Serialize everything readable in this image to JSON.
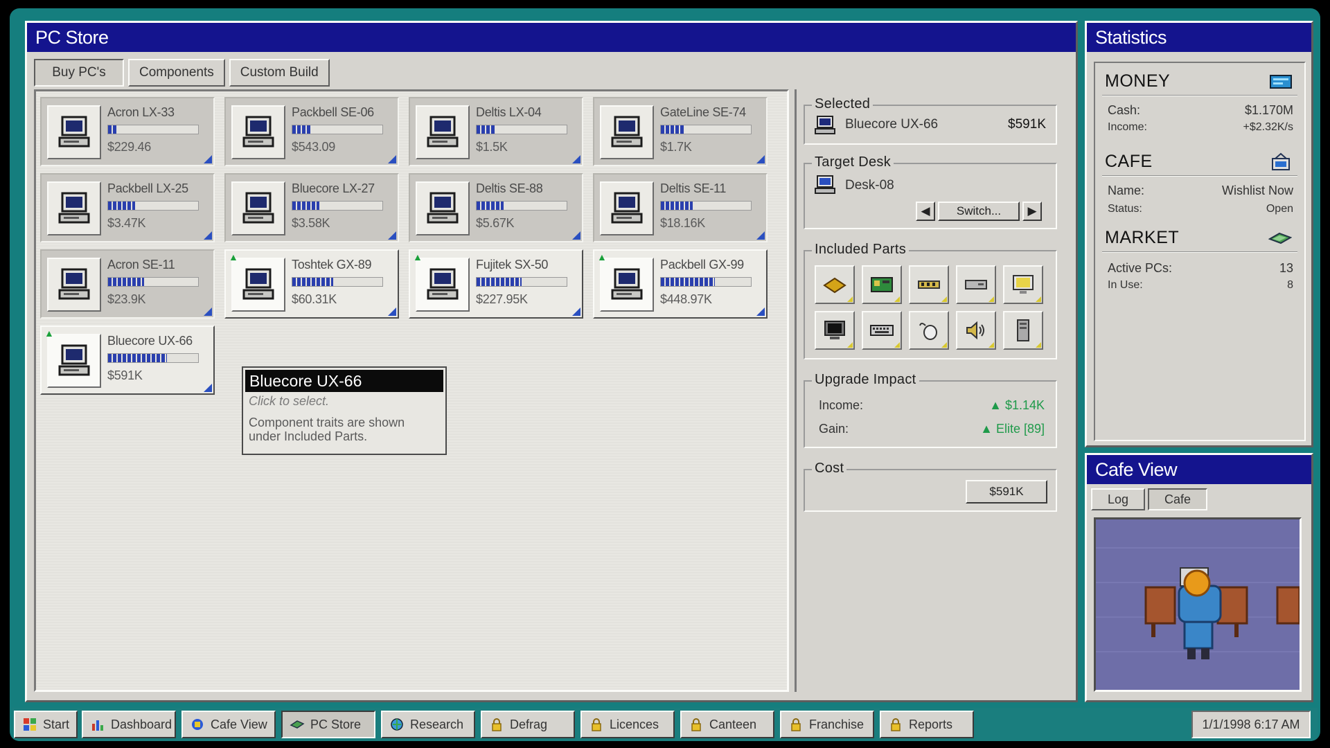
{
  "pc_store": {
    "title": "PC Store",
    "tabs": [
      "Buy PC's",
      "Components",
      "Custom Build"
    ],
    "products": [
      {
        "name": "Acron LX-33",
        "price": "$229.46",
        "rating": 0.1,
        "owned": false,
        "upgrade": false
      },
      {
        "name": "Packbell SE-06",
        "price": "$543.09",
        "rating": 0.2,
        "owned": false,
        "upgrade": false
      },
      {
        "name": "Deltis LX-04",
        "price": "$1.5K",
        "rating": 0.2,
        "owned": false,
        "upgrade": false
      },
      {
        "name": "GateLine SE-74",
        "price": "$1.7K",
        "rating": 0.25,
        "owned": false,
        "upgrade": false
      },
      {
        "name": "Packbell LX-25",
        "price": "$3.47K",
        "rating": 0.3,
        "owned": false,
        "upgrade": false
      },
      {
        "name": "Bluecore LX-27",
        "price": "$3.58K",
        "rating": 0.3,
        "owned": false,
        "upgrade": false
      },
      {
        "name": "Deltis SE-88",
        "price": "$5.67K",
        "rating": 0.3,
        "owned": false,
        "upgrade": false
      },
      {
        "name": "Deltis SE-11",
        "price": "$18.16K",
        "rating": 0.35,
        "owned": false,
        "upgrade": false
      },
      {
        "name": "Acron SE-11",
        "price": "$23.9K",
        "rating": 0.4,
        "owned": false,
        "upgrade": false
      },
      {
        "name": "Toshtek GX-89",
        "price": "$60.31K",
        "rating": 0.45,
        "owned": true,
        "upgrade": true
      },
      {
        "name": "Fujitek SX-50",
        "price": "$227.95K",
        "rating": 0.5,
        "owned": true,
        "upgrade": true
      },
      {
        "name": "Packbell GX-99",
        "price": "$448.97K",
        "rating": 0.6,
        "owned": true,
        "upgrade": true
      },
      {
        "name": "Bluecore UX-66",
        "price": "$591K",
        "rating": 0.65,
        "owned": true,
        "upgrade": true
      }
    ],
    "tooltip": {
      "title": "Bluecore UX-66",
      "hint": "Click to select.",
      "body": "Component traits are shown under Included Parts."
    },
    "selected": {
      "legend": "Selected",
      "name": "Bluecore UX-66",
      "price": "$591K"
    },
    "target_desk": {
      "legend": "Target Desk",
      "desk": "Desk-08",
      "switch_label": "Switch..."
    },
    "included_parts": {
      "legend": "Included Parts",
      "parts": [
        "cpu-icon",
        "motherboard-icon",
        "ram-icon",
        "drive-icon",
        "monitor-icon",
        "crt-icon",
        "keyboard-icon",
        "mouse-icon",
        "speaker-icon",
        "tower-icon"
      ]
    },
    "upgrade_impact": {
      "legend": "Upgrade Impact",
      "income_label": "Income:",
      "income_value": "▲ $1.14K",
      "gain_label": "Gain:",
      "gain_value": "▲ Elite [89]"
    },
    "cost": {
      "legend": "Cost",
      "button": "$591K"
    }
  },
  "statistics": {
    "title": "Statistics",
    "money": {
      "heading": "MONEY",
      "cash_label": "Cash:",
      "cash": "$1.170M",
      "income_label": "Income:",
      "income": "+$2.32K/s"
    },
    "cafe": {
      "heading": "CAFE",
      "name_label": "Name:",
      "name": "Wishlist Now",
      "status_label": "Status:",
      "status": "Open"
    },
    "market": {
      "heading": "MARKET",
      "active_label": "Active PCs:",
      "active": "13",
      "inuse_label": "In Use:",
      "inuse": "8"
    }
  },
  "cafe_view": {
    "title": "Cafe View",
    "tabs": [
      "Log",
      "Cafe"
    ]
  },
  "taskbar": {
    "items": [
      "Start",
      "Dashboard",
      "Cafe View",
      "PC Store",
      "Research",
      "Defrag",
      "Licences",
      "Canteen",
      "Franchise",
      "Reports"
    ],
    "clock": "1/1/1998 6:17 AM"
  },
  "colors": {
    "titlebar": "#14148e",
    "desktop": "#157e7e",
    "accent_gain": "#1f9a4a"
  }
}
